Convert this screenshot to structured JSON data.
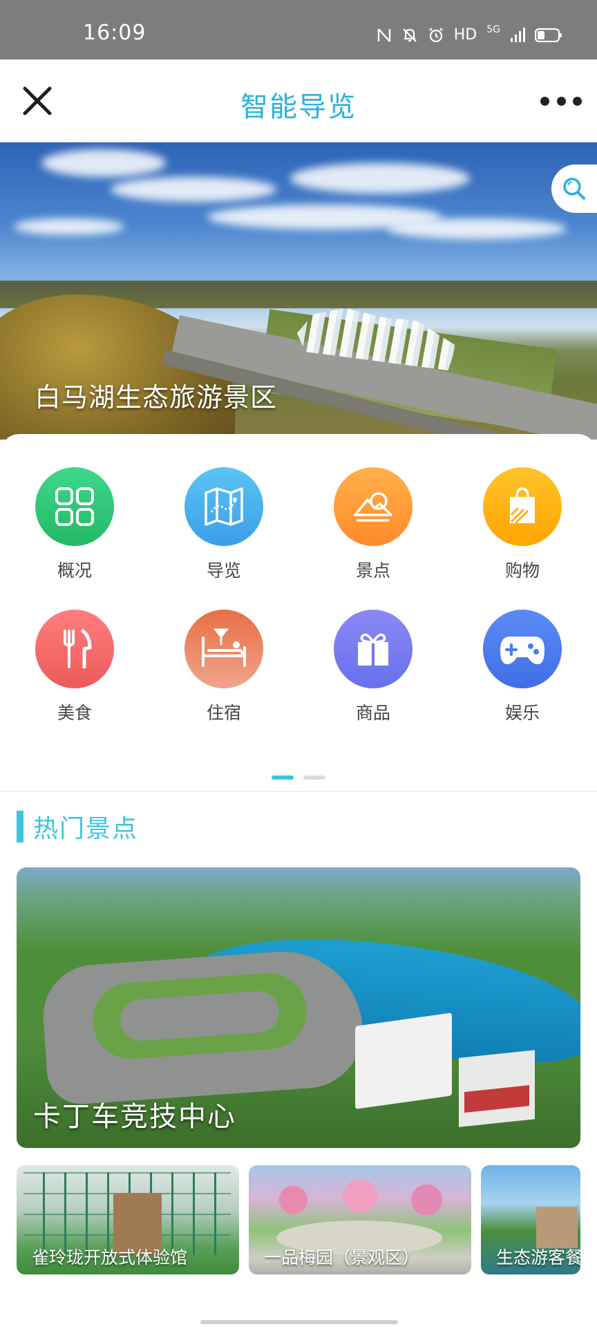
{
  "status_bar": {
    "time": "16:09",
    "network": "HD",
    "net_gen": "5G"
  },
  "header": {
    "title": "智能导览"
  },
  "hero": {
    "caption": "白马湖生态旅游景区"
  },
  "menu": [
    {
      "label": "概况",
      "icon": "grid-icon",
      "color": "#2fc577"
    },
    {
      "label": "导览",
      "icon": "map-icon",
      "color": "#41aef0"
    },
    {
      "label": "景点",
      "icon": "scenery-icon",
      "color": "#ff9f3a"
    },
    {
      "label": "购物",
      "icon": "shopping-bag-icon",
      "color": "#ffb01a"
    },
    {
      "label": "美食",
      "icon": "fork-knife-icon",
      "color": "#f06868"
    },
    {
      "label": "住宿",
      "icon": "bed-icon",
      "color": "#e8845a"
    },
    {
      "label": "商品",
      "icon": "gift-icon",
      "color": "#7b7ef0"
    },
    {
      "label": "娱乐",
      "icon": "gamepad-icon",
      "color": "#4b7cf0"
    }
  ],
  "pager": {
    "pages": 2,
    "current": 0
  },
  "hot": {
    "title": "热门景点",
    "featured": {
      "caption": "卡丁车竞技中心"
    },
    "items": [
      {
        "caption": "雀玲珑开放式体验馆"
      },
      {
        "caption": "一品梅园（景观区）"
      },
      {
        "caption": "生态游客餐"
      }
    ]
  }
}
